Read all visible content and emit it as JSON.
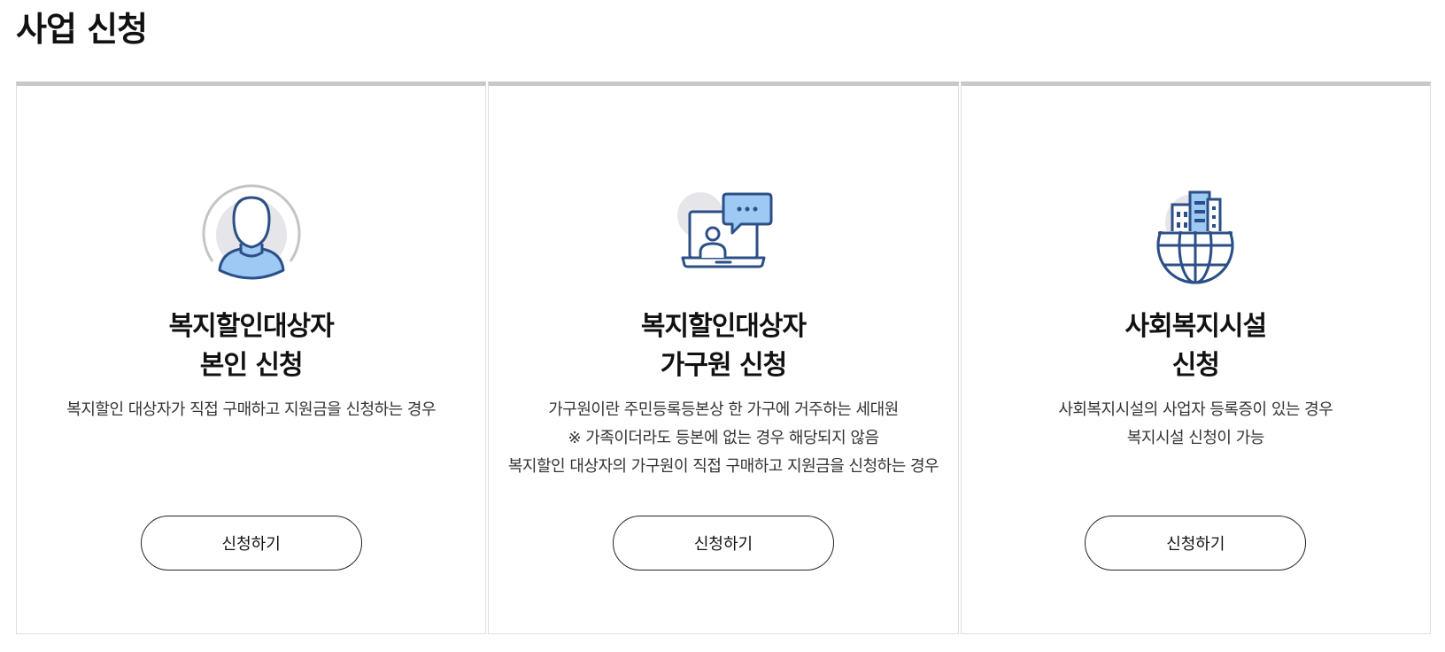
{
  "page": {
    "title": "사업 신청"
  },
  "cards": [
    {
      "icon": "person-icon",
      "title_line1": "복지할인대상자",
      "title_line2": "본인 신청",
      "desc": [
        "복지할인 대상자가 직접 구매하고 지원금을 신청하는 경우"
      ],
      "button": "신청하기"
    },
    {
      "icon": "laptop-chat-icon",
      "title_line1": "복지할인대상자",
      "title_line2": "가구원 신청",
      "desc": [
        "가구원이란 주민등록등본상 한 가구에 거주하는 세대원",
        "※ 가족이더라도 등본에 없는 경우 해당되지 않음",
        "복지할인 대상자의 가구원이 직접 구매하고 지원금을 신청하는 경우"
      ],
      "button": "신청하기"
    },
    {
      "icon": "building-globe-icon",
      "title_line1": "사회복지시설",
      "title_line2": "신청",
      "desc": [
        "사회복지시설의 사업자 등록증이 있는 경우",
        "복지시설 신청이 가능"
      ],
      "button": "신청하기"
    }
  ],
  "colors": {
    "icon_stroke": "#2b4f86",
    "icon_fill": "#9ec9f5",
    "icon_bg": "#e6e6ea",
    "card_top_border": "#c8c8c8"
  }
}
